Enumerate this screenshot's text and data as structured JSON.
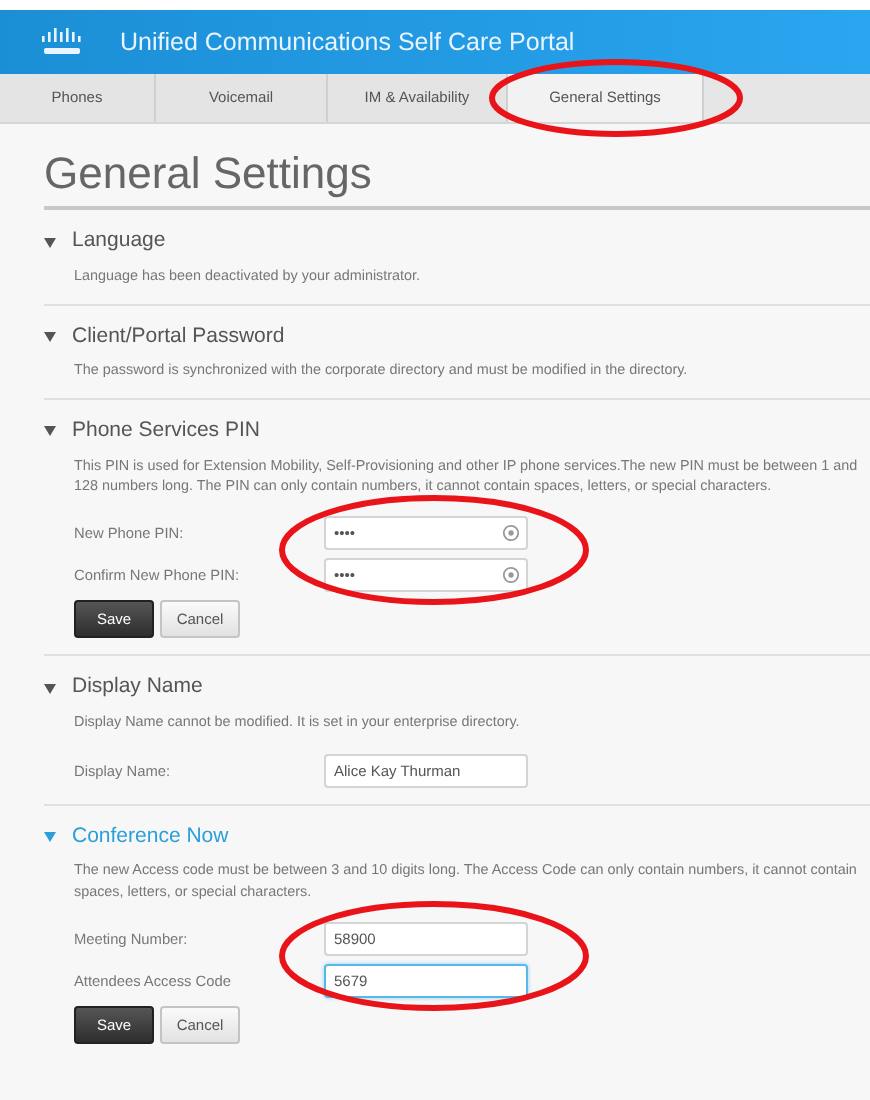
{
  "header": {
    "title": "Unified Communications Self Care Portal"
  },
  "tabs": [
    {
      "label": "Phones",
      "selected": false,
      "highlighted": false
    },
    {
      "label": "Voicemail",
      "selected": false,
      "highlighted": false
    },
    {
      "label": "IM & Availability",
      "selected": false,
      "highlighted": false
    },
    {
      "label": "General Settings",
      "selected": true,
      "highlighted": true
    }
  ],
  "page_title": "General Settings",
  "sections": [
    {
      "title": "Language",
      "expanded": true,
      "active": false,
      "description": "Language has been deactivated by your administrator."
    },
    {
      "title": "Client/Portal Password",
      "expanded": true,
      "active": false,
      "description": "The password is synchronized with the corporate directory and must be modified in the directory."
    },
    {
      "title": "Phone Services PIN",
      "expanded": true,
      "active": false,
      "description": "This PIN is used for Extension Mobility, Self-Provisioning and other IP phone services.The new PIN must be between 1 and 128 numbers long. The PIN can only contain numbers, it cannot contain spaces, letters, or special characters.",
      "highlighted_fields": true,
      "fields": [
        {
          "label": "New Phone PIN:",
          "value": "••••",
          "kind": "secret",
          "focused": false
        },
        {
          "label": "Confirm New Phone PIN:",
          "value": "••••",
          "kind": "secret",
          "focused": false
        }
      ],
      "buttons": [
        {
          "label": "Save",
          "kind": "primary"
        },
        {
          "label": "Cancel",
          "kind": "secondary"
        }
      ]
    },
    {
      "title": "Display Name",
      "expanded": true,
      "active": false,
      "description": "Display Name cannot be modified. It is set in your enterprise directory.",
      "highlighted_fields": false,
      "fields": [
        {
          "label": "Display Name:",
          "value": "Alice Kay Thurman",
          "kind": "text",
          "focused": false
        }
      ]
    },
    {
      "title": "Conference Now",
      "expanded": true,
      "active": true,
      "description": "The new Access code must be between 3 and 10 digits long. The Access Code can only contain numbers, it cannot contain spaces, letters, or special characters.",
      "highlighted_fields": true,
      "fields": [
        {
          "label": "Meeting Number:",
          "value": "58900",
          "kind": "text",
          "focused": false
        },
        {
          "label": "Attendees Access Code",
          "value": "5679",
          "kind": "text",
          "focused": true
        }
      ],
      "buttons": [
        {
          "label": "Save",
          "kind": "primary"
        },
        {
          "label": "Cancel",
          "kind": "secondary"
        }
      ]
    }
  ]
}
